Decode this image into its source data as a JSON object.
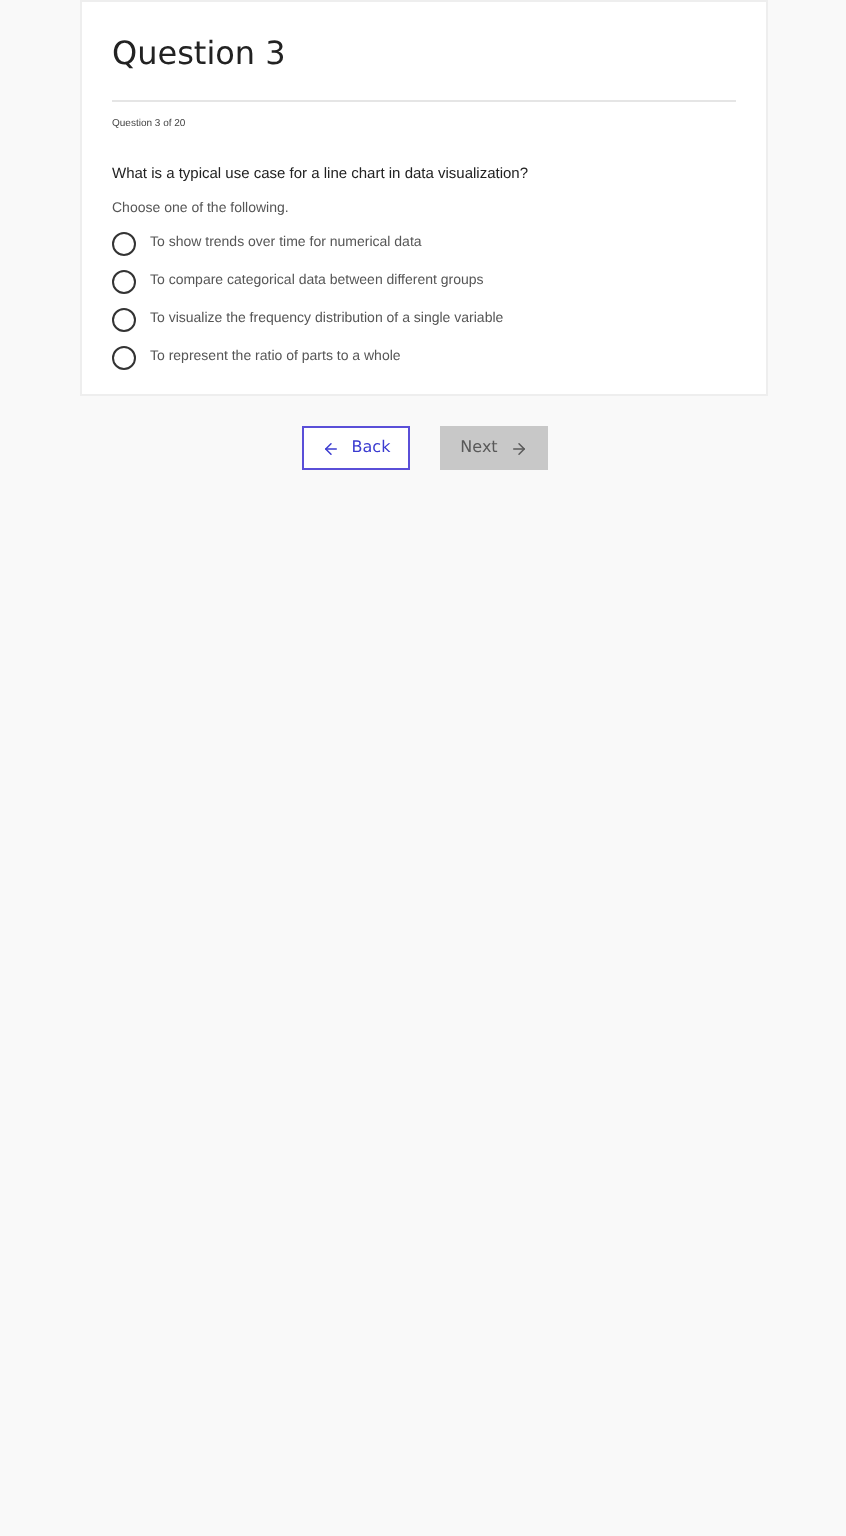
{
  "title": "Question 3",
  "progress": "Question 3 of 20",
  "question": "What is a typical use case for a line chart in data visualization?",
  "instruction": "Choose one of the following.",
  "options": [
    {
      "label": "To show trends over time for numerical data",
      "selected": false
    },
    {
      "label": "To compare categorical data between different groups",
      "selected": false
    },
    {
      "label": "To visualize the frequency distribution of a single variable",
      "selected": false
    },
    {
      "label": "To represent the ratio of parts to a whole",
      "selected": false
    }
  ],
  "back_button": {
    "label": "Back",
    "disabled": false
  },
  "next_button": {
    "label": "Next",
    "disabled": true
  }
}
